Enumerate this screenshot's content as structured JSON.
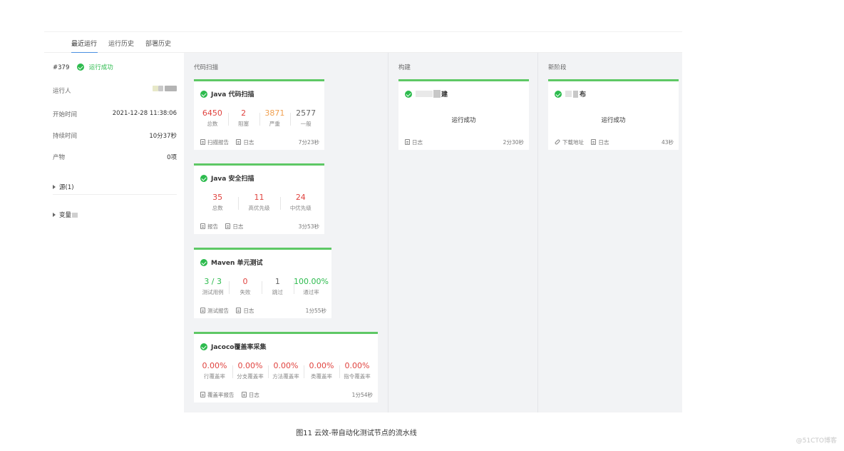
{
  "tabs": [
    {
      "label": "最近运行",
      "active": true
    },
    {
      "label": "运行历史",
      "active": false
    },
    {
      "label": "部署历史",
      "active": false
    }
  ],
  "sidebar": {
    "run_number": "#379",
    "run_status": "运行成功",
    "runner_label": "运行人",
    "start_label": "开始时间",
    "start_value": "2021-12-28 11:38:06",
    "duration_label": "持续时间",
    "duration_value": "10分37秒",
    "artifact_label": "产物",
    "artifact_value": "0项",
    "source_label": "源(1)",
    "variables_label": "变量"
  },
  "stages": [
    {
      "title": "代码扫描",
      "jobs": [
        {
          "name": "Java 代码扫描",
          "metrics": [
            {
              "value": "6450",
              "label": "总数",
              "color": "#e0433f"
            },
            {
              "value": "2",
              "label": "阻塞",
              "color": "#e0433f"
            },
            {
              "value": "3871",
              "label": "严重",
              "color": "#f0a050"
            },
            {
              "value": "2577",
              "label": "一般",
              "color": "#666666"
            }
          ],
          "links": [
            "扫描报告",
            "日志"
          ],
          "duration": "7分23秒"
        },
        {
          "name": "Java 安全扫描",
          "metrics": [
            {
              "value": "35",
              "label": "总数",
              "color": "#e0433f"
            },
            {
              "value": "11",
              "label": "高优先级",
              "color": "#e0433f"
            },
            {
              "value": "24",
              "label": "中优先级",
              "color": "#e0433f"
            }
          ],
          "links": [
            "报告",
            "日志"
          ],
          "duration": "3分53秒"
        },
        {
          "name": "Maven 单元测试",
          "metrics": [
            {
              "value": "3 / 3",
              "label": "测试用例",
              "color": "#2dbb4e"
            },
            {
              "value": "0",
              "label": "失败",
              "color": "#e0433f"
            },
            {
              "value": "1",
              "label": "跳过",
              "color": "#666666"
            },
            {
              "value": "100.00%",
              "label": "通过率",
              "color": "#2dbb4e"
            }
          ],
          "links": [
            "测试报告",
            "日志"
          ],
          "duration": "1分55秒"
        },
        {
          "name": "Jacoco覆盖率采集",
          "metrics": [
            {
              "value": "0.00%",
              "label": "行覆盖率",
              "color": "#e0433f"
            },
            {
              "value": "0.00%",
              "label": "分支覆盖率",
              "color": "#e0433f"
            },
            {
              "value": "0.00%",
              "label": "方法覆盖率",
              "color": "#e0433f"
            },
            {
              "value": "0.00%",
              "label": "类覆盖率",
              "color": "#e0433f"
            },
            {
              "value": "0.00%",
              "label": "指令覆盖率",
              "color": "#e0433f"
            }
          ],
          "links": [
            "覆盖率报告",
            "日志"
          ],
          "duration": "1分54秒"
        }
      ]
    },
    {
      "title": "构建",
      "jobs": [
        {
          "name": "建",
          "status": "运行成功",
          "links": [
            "日志"
          ],
          "duration": "2分30秒"
        }
      ]
    },
    {
      "title": "新阶段",
      "jobs": [
        {
          "name": "布",
          "status": "运行成功",
          "links": [
            "下载地址",
            "日志"
          ],
          "duration": "43秒"
        }
      ]
    }
  ],
  "caption": "图11 云效-带自动化测试节点的流水线",
  "watermark": "@51CTO博客"
}
